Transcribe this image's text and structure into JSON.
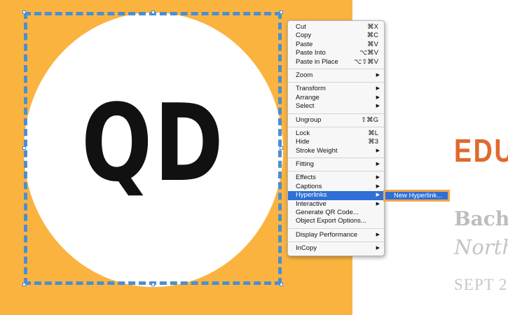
{
  "canvas": {
    "logo_text": "QD",
    "colors": {
      "orange": "#fbb340",
      "selection": "#4b8fd1",
      "heading_orange": "#e06a2c",
      "menu_highlight": "#2f6fd6"
    }
  },
  "resume": {
    "heading": "EDU",
    "degree": "Bach",
    "school": "North",
    "date": "SEPT 2"
  },
  "context_menu": {
    "items": [
      {
        "label": "Cut",
        "shortcut": "⌘X"
      },
      {
        "label": "Copy",
        "shortcut": "⌘C"
      },
      {
        "label": "Paste",
        "shortcut": "⌘V"
      },
      {
        "label": "Paste Into",
        "shortcut": "⌥⌘V"
      },
      {
        "label": "Paste in Place",
        "shortcut": "⌥⇧⌘V"
      },
      {
        "label": "Zoom",
        "shortcut": ""
      },
      {
        "label": "Transform",
        "shortcut": ""
      },
      {
        "label": "Arrange",
        "shortcut": ""
      },
      {
        "label": "Select",
        "shortcut": ""
      },
      {
        "label": "Ungroup",
        "shortcut": "⇧⌘G"
      },
      {
        "label": "Lock",
        "shortcut": "⌘L"
      },
      {
        "label": "Hide",
        "shortcut": "⌘3"
      },
      {
        "label": "Stroke Weight",
        "shortcut": ""
      },
      {
        "label": "Fitting",
        "shortcut": ""
      },
      {
        "label": "Effects",
        "shortcut": ""
      },
      {
        "label": "Captions",
        "shortcut": ""
      },
      {
        "label": "Hyperlinks",
        "shortcut": ""
      },
      {
        "label": "Interactive",
        "shortcut": ""
      },
      {
        "label": "Generate QR Code...",
        "shortcut": ""
      },
      {
        "label": "Object Export Options...",
        "shortcut": ""
      },
      {
        "label": "Display Performance",
        "shortcut": ""
      },
      {
        "label": "InCopy",
        "shortcut": ""
      }
    ],
    "submenu_arrow": "▶"
  },
  "submenu": {
    "label": "New Hyperlink..."
  }
}
